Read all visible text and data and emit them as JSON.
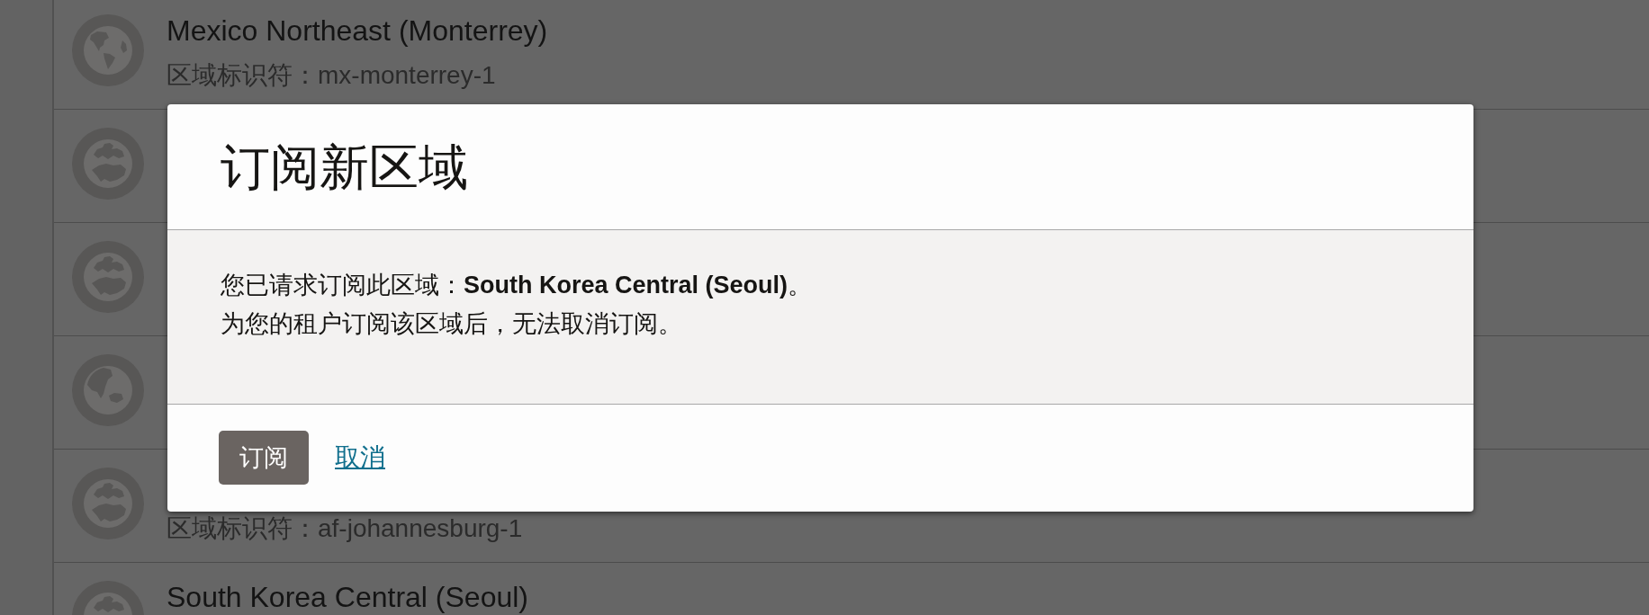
{
  "regions": [
    {
      "kind": "region",
      "title": "Mexico Northeast (Monterrey)",
      "identifier": "区域标识符：mx-monterrey-1"
    },
    {
      "kind": "region"
    },
    {
      "kind": "region"
    },
    {
      "kind": "region"
    },
    {
      "kind": "region",
      "identifier": "区域标识符：af-johannesburg-1"
    },
    {
      "kind": "region",
      "title": "South Korea Central (Seoul)"
    }
  ],
  "dialog": {
    "title": "订阅新区域",
    "message": [
      "您已请求订阅此区域：**South Korea Central (Seoul)**。",
      "为您的租户订阅该区域后，无法取消订阅。"
    ],
    "buttons": [
      {
        "kind": "primary",
        "label": "订阅"
      },
      {
        "kind": "link",
        "label": "取消"
      }
    ]
  }
}
